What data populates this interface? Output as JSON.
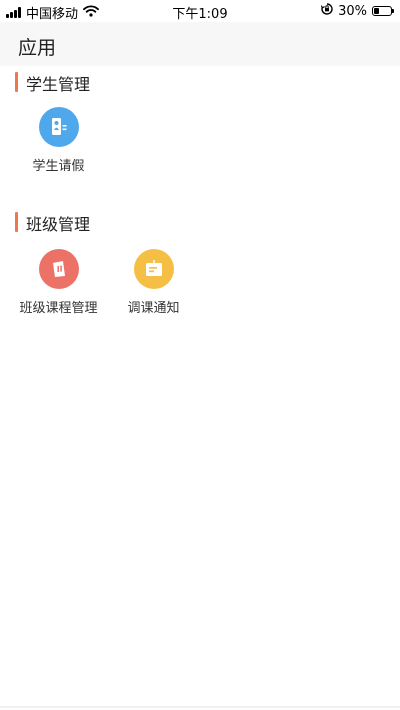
{
  "status_bar": {
    "carrier": "中国移动",
    "time": "下午1:09",
    "battery_percent": "30%",
    "battery_level": 0.3,
    "icons": [
      "signal-icon",
      "wifi-icon",
      "orientation-lock-icon",
      "battery-icon"
    ]
  },
  "header": {
    "title": "应用"
  },
  "sections": [
    {
      "title": "学生管理",
      "apps": [
        {
          "label": "学生请假",
          "icon": "student-id-icon",
          "color": "#4fa8ec"
        }
      ]
    },
    {
      "title": "班级管理",
      "apps": [
        {
          "label": "班级课程管理",
          "icon": "course-book-icon",
          "color": "#ec7167"
        },
        {
          "label": "调课通知",
          "icon": "notice-board-icon",
          "color": "#f5bf45"
        }
      ]
    }
  ],
  "colors": {
    "accent": "#f0774d",
    "header_bg": "#f7f7f7"
  }
}
